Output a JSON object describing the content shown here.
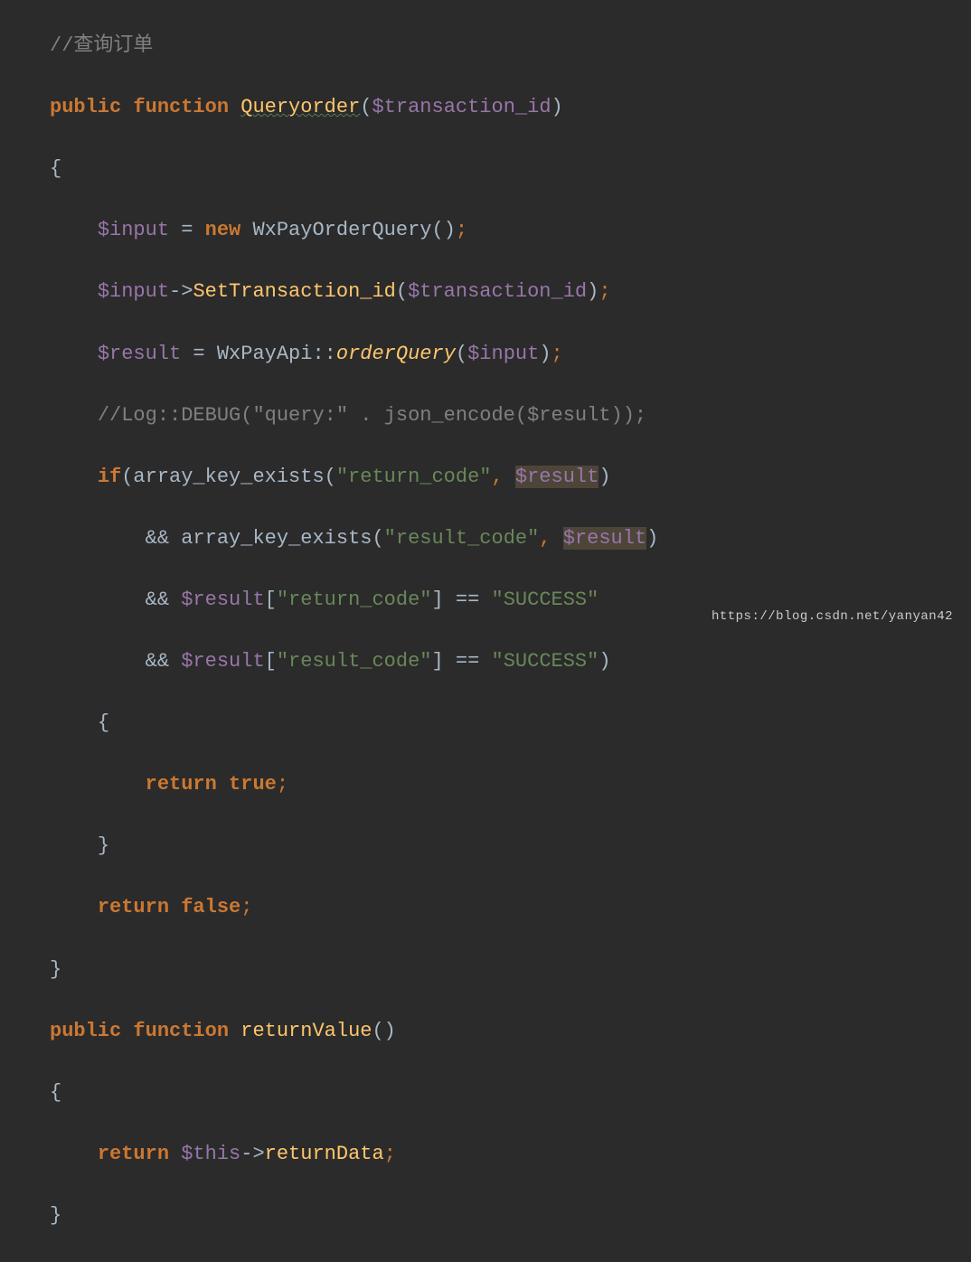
{
  "code": {
    "line1": {
      "comment": "//查询订单"
    },
    "line2": {
      "kw_public": "public",
      "kw_function": "function",
      "fn_name": "Queryorder",
      "paren_open": "(",
      "var": "$transaction_id",
      "paren_close": ")"
    },
    "line3": {
      "brace": "{"
    },
    "line4": {
      "var_input": "$input",
      "eq": " = ",
      "kw_new": "new",
      "class": "WxPayOrderQuery",
      "parens": "()",
      "semi": ";"
    },
    "line5": {
      "var_input": "$input",
      "arrow": "->",
      "method": "SetTransaction_id",
      "paren_open": "(",
      "var": "$transaction_id",
      "paren_close": ")",
      "semi": ";"
    },
    "line6": {
      "var_result": "$result",
      "eq": " = ",
      "class": "WxPayApi",
      "dblcolon": "::",
      "method": "orderQuery",
      "paren_open": "(",
      "var_input": "$input",
      "paren_close": ")",
      "semi": ";"
    },
    "line7": {
      "comment": "//Log::DEBUG(\"query:\" . json_encode($result));"
    },
    "line8": {
      "kw_if": "if",
      "paren_open": "(",
      "fn": "array_key_exists",
      "paren2_open": "(",
      "str": "\"return_code\"",
      "comma": ",",
      "var": "$result",
      "paren2_close": ")"
    },
    "line9": {
      "op_and": "&&",
      "fn": "array_key_exists",
      "paren_open": "(",
      "str": "\"result_code\"",
      "comma": ",",
      "var": "$result",
      "paren_close": ")"
    },
    "line10": {
      "op_and": "&&",
      "var": "$result",
      "bracket_open": "[",
      "str": "\"return_code\"",
      "bracket_close": "]",
      "eq": " == ",
      "str2": "\"SUCCESS\""
    },
    "line11": {
      "op_and": "&&",
      "var": "$result",
      "bracket_open": "[",
      "str": "\"result_code\"",
      "bracket_close": "]",
      "eq": " == ",
      "str2": "\"SUCCESS\"",
      "paren_close": ")"
    },
    "line12": {
      "brace": "{"
    },
    "line13": {
      "kw_return": "return",
      "kw_true": "true",
      "semi": ";"
    },
    "line14": {
      "brace": "}"
    },
    "line15": {
      "kw_return": "return",
      "kw_false": "false",
      "semi": ";"
    },
    "line16": {
      "brace": "}"
    },
    "line17": {
      "kw_public": "public",
      "kw_function": "function",
      "fn_name": "returnValue",
      "parens": "()"
    },
    "line18": {
      "brace": "{"
    },
    "line19": {
      "kw_return": "return",
      "var_this": "$this",
      "arrow": "->",
      "prop": "returnData",
      "semi": ";"
    },
    "line20": {
      "brace": "}"
    }
  },
  "watermark": "https://blog.csdn.net/yanyan42"
}
